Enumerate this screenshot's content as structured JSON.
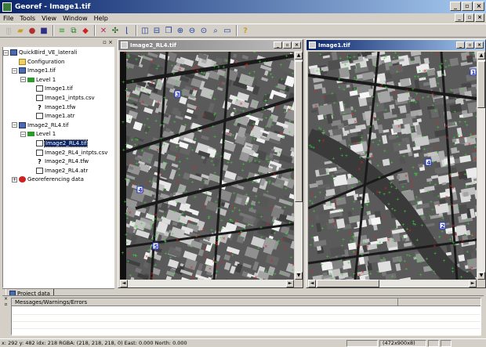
{
  "window": {
    "title": "Georef - Image1.tif"
  },
  "menu": [
    "File",
    "Tools",
    "View",
    "Window",
    "Help"
  ],
  "tree": {
    "nodes": [
      {
        "label": "QuickBird_VE_laterali",
        "icon": "project-icon",
        "expander": "-",
        "depth": 0
      },
      {
        "label": "Configuration",
        "icon": "folder-icon",
        "expander": "",
        "depth": 1
      },
      {
        "label": "Image1.tif",
        "icon": "image-set-icon",
        "expander": "-",
        "depth": 1
      },
      {
        "label": "Level 1",
        "icon": "layer-icon",
        "expander": "-",
        "depth": 2
      },
      {
        "label": "Image1.tif",
        "icon": "document-icon",
        "expander": "",
        "depth": 3
      },
      {
        "label": "Image1_intpts.csv",
        "icon": "document-icon",
        "expander": "",
        "depth": 3
      },
      {
        "label": "Image1.tfw",
        "icon": "unknown-file-icon",
        "expander": "",
        "depth": 3
      },
      {
        "label": "Image1.atr",
        "icon": "document-icon",
        "expander": "",
        "depth": 3
      },
      {
        "label": "Image2_RL4.tif",
        "icon": "image-set-icon",
        "expander": "-",
        "depth": 1
      },
      {
        "label": "Level 1",
        "icon": "layer-icon",
        "expander": "-",
        "depth": 2
      },
      {
        "label": "Image2_RL4.tif",
        "icon": "document-icon",
        "expander": "",
        "depth": 3,
        "selected": true
      },
      {
        "label": "Image2_RL4_intpts.csv",
        "icon": "document-icon",
        "expander": "",
        "depth": 3
      },
      {
        "label": "Image2_RL4.tfw",
        "icon": "unknown-file-icon",
        "expander": "",
        "depth": 3
      },
      {
        "label": "Image2_RL4.atr",
        "icon": "document-icon",
        "expander": "",
        "depth": 3
      },
      {
        "label": "Georeferencing data",
        "icon": "georef-icon",
        "expander": "+",
        "depth": 1
      }
    ],
    "tab_label": "Project data"
  },
  "windows": {
    "left": {
      "title": "Image2_RL4.tif"
    },
    "right": {
      "title": "Image1.tif"
    }
  },
  "markers": {
    "left": [
      "3",
      "4",
      "5"
    ],
    "right": [
      "1",
      "2",
      "4"
    ]
  },
  "messages": {
    "header": "Messages/Warnings/Errors"
  },
  "status": {
    "main": "x: 292 y: 482 idx: 218 RGBA: (218, 218, 218, 0) East: 0.000 North: 0.000",
    "size": "(472x900x8)"
  },
  "colors": {
    "titlebar": "#0a246a",
    "selection": "#0a246a",
    "face": "#d4d0c8"
  }
}
